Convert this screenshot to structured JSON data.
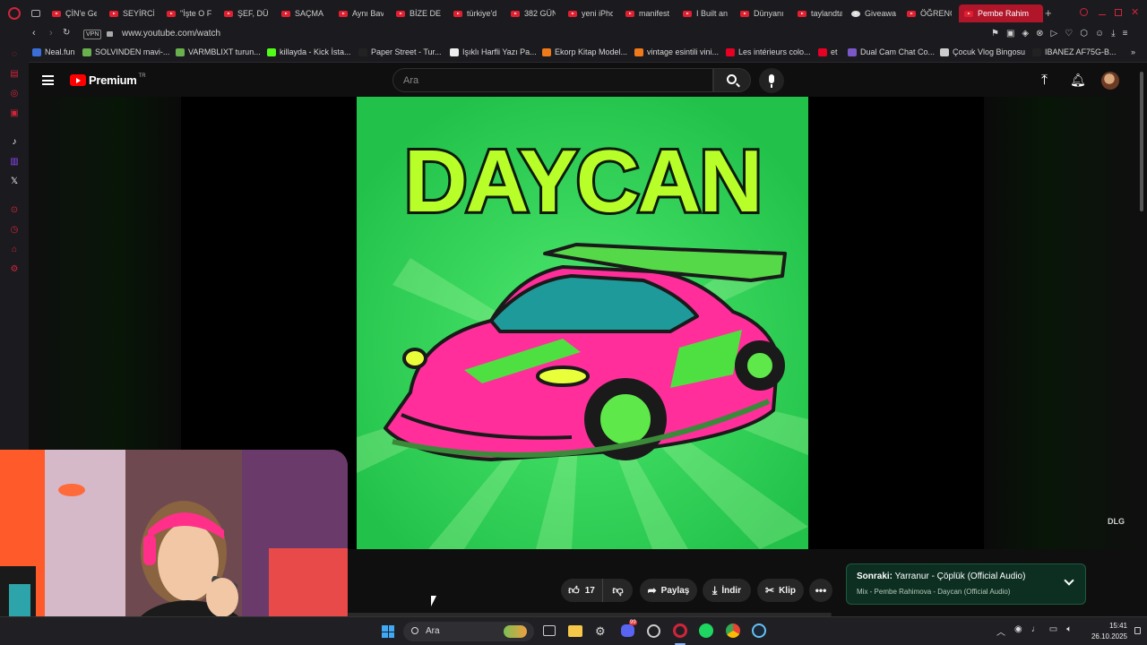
{
  "browser": {
    "tabs": [
      {
        "label": "ÇİN'e Gel"
      },
      {
        "label": "SEYİRCİ"
      },
      {
        "label": "\"İşte O F"
      },
      {
        "label": "ŞEF, DÜŞ"
      },
      {
        "label": "SAÇMA"
      },
      {
        "label": "Aynı Bav"
      },
      {
        "label": "BİZE DE"
      },
      {
        "label": "türkiye'd"
      },
      {
        "label": "382 GÜN"
      },
      {
        "label": "yeni iPho"
      },
      {
        "label": "manifest"
      },
      {
        "label": "I Built an"
      },
      {
        "label": "Dünyanı"
      },
      {
        "label": "taylandta"
      },
      {
        "label": "Giveawa"
      },
      {
        "label": "ÖĞRENC"
      },
      {
        "label": "Pembe Rahim"
      }
    ],
    "url": "www.youtube.com/watch",
    "vpn_label": "VPN",
    "bookmarks": [
      {
        "label": "Neal.fun",
        "color": "#3a6fd8"
      },
      {
        "label": "SOLVINDEN mavi-...",
        "color": "#6ab04c"
      },
      {
        "label": "VARMBLIXT turun...",
        "color": "#6ab04c"
      },
      {
        "label": "killayda - Kick İsta...",
        "color": "#53fc18"
      },
      {
        "label": "Paper Street - Tur...",
        "color": "#222222"
      },
      {
        "label": "Işıklı Harfli Yazı Pa...",
        "color": "#eeeeee"
      },
      {
        "label": "Ekorp Kitap Model...",
        "color": "#f07a1a"
      },
      {
        "label": "vintage esintili vini...",
        "color": "#f07a1a"
      },
      {
        "label": "Les intérieurs colo...",
        "color": "#e60023"
      },
      {
        "label": "et",
        "color": "#e60023"
      },
      {
        "label": "Dual Cam Chat Co...",
        "color": "#7a58c8"
      },
      {
        "label": "Çocuk Vlog Bingosu",
        "color": "#cccccc"
      },
      {
        "label": "IBANEZ AF75G-B...",
        "color": "#222222"
      }
    ]
  },
  "youtube": {
    "logo_text": "Premium",
    "logo_region": "TR",
    "search_placeholder": "Ara",
    "video_title_art": "DAYCAN",
    "watermark": "DLG",
    "actions": {
      "like_count": "17",
      "share_label": "Paylaş",
      "download_label": "İndir",
      "clip_label": "Klip"
    },
    "next_up": {
      "prefix": "Sonraki:",
      "title": "Yarranur - Çöplük (Official Audio)",
      "subtitle": "Mix - Pembe Rahimova - Daycan (Official Audio)"
    }
  },
  "taskbar": {
    "search_placeholder": "Ara",
    "time": "15:41",
    "date": "26.10.2025",
    "discord_badge": "99"
  }
}
